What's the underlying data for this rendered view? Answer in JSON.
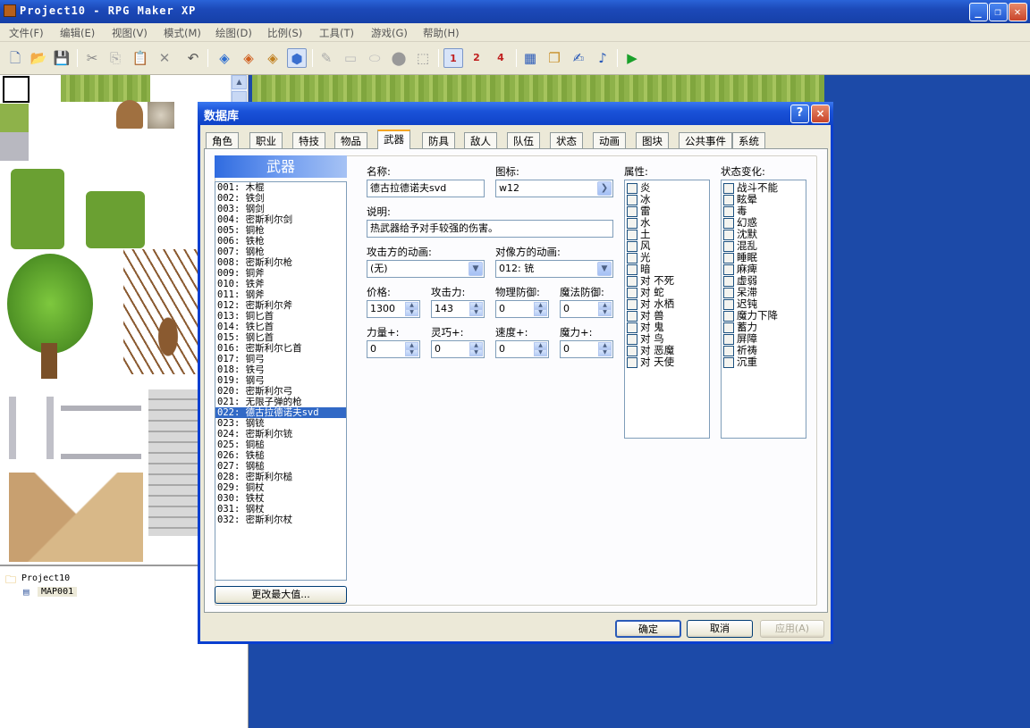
{
  "app": {
    "title": "Project10 - RPG Maker XP"
  },
  "menu": [
    "文件(F)",
    "编辑(E)",
    "视图(V)",
    "模式(M)",
    "绘图(D)",
    "比例(S)",
    "工具(T)",
    "游戏(G)",
    "帮助(H)"
  ],
  "toolbar_icons": [
    "new-icon",
    "open-icon",
    "save-icon",
    "cut-icon",
    "copy-icon",
    "paste-icon",
    "delete-icon",
    "undo-icon",
    "layer1-icon",
    "layer2-icon",
    "layer3-icon",
    "events-icon",
    "pencil-icon",
    "rectangle-icon",
    "ellipse-icon",
    "fill-icon",
    "select-icon",
    "zoom-1-icon",
    "zoom-2-icon",
    "zoom-4-icon",
    "database-icon",
    "materials-icon",
    "script-icon",
    "sound-icon",
    "play-icon"
  ],
  "map_tree": {
    "project": "Project10",
    "map": "MAP001"
  },
  "dialog": {
    "title": "数据库",
    "help_button": "?",
    "close_button": "×",
    "tabs": [
      "角色",
      "职业",
      "特技",
      "物品",
      "武器",
      "防具",
      "敌人",
      "队伍",
      "状态",
      "动画",
      "图块",
      "公共事件",
      "系统"
    ],
    "selected_tab": "武器",
    "list_header": "武器",
    "weapons": [
      "001: 木棍",
      "002: 铁剑",
      "003: 钢剑",
      "004: 密斯利尔剑",
      "005: 铜枪",
      "006: 铁枪",
      "007: 钢枪",
      "008: 密斯利尔枪",
      "009: 铜斧",
      "010: 铁斧",
      "011: 钢斧",
      "012: 密斯利尔斧",
      "013: 铜匕首",
      "014: 铁匕首",
      "015: 钢匕首",
      "016: 密斯利尔匕首",
      "017: 铜弓",
      "018: 铁弓",
      "019: 钢弓",
      "020: 密斯利尔弓",
      "021: 无限子弹的枪",
      "022: 德古拉德诺夫svd",
      "023: 钢铳",
      "024: 密斯利尔铳",
      "025: 铜槌",
      "026: 铁槌",
      "027: 钢槌",
      "028: 密斯利尔槌",
      "029: 铜杖",
      "030: 铁杖",
      "031: 钢杖",
      "032: 密斯利尔杖"
    ],
    "selected_weapon": "022: 德古拉德诺夫svd",
    "max_button": "更改最大值...",
    "form": {
      "name_label": "名称:",
      "name_value": "德古拉德诺夫svd",
      "icon_label": "图标:",
      "icon_value": "w12",
      "desc_label": "说明:",
      "desc_value": "热武器给予对手较强的伤害。",
      "attacker_anim_label": "攻击方的动画:",
      "attacker_anim_value": "(无)",
      "target_anim_label": "对像方的动画:",
      "target_anim_value": "012: 铳",
      "price_label": "价格:",
      "price_value": "1300",
      "atk_label": "攻击力:",
      "atk_value": "143",
      "pdef_label": "物理防御:",
      "pdef_value": "0",
      "mdef_label": "魔法防御:",
      "mdef_value": "0",
      "str_label": "力量+:",
      "str_value": "0",
      "dex_label": "灵巧+:",
      "dex_value": "0",
      "agi_label": "速度+:",
      "agi_value": "0",
      "int_label": "魔力+:",
      "int_value": "0"
    },
    "elements_label": "属性:",
    "elements": [
      "炎",
      "冰",
      "雷",
      "水",
      "土",
      "风",
      "光",
      "暗",
      "对 不死",
      "对 蛇",
      "对 水栖",
      "对 兽",
      "对 鬼",
      "对 鸟",
      "对 恶魔",
      "对 天使"
    ],
    "states_label": "状态变化:",
    "states": [
      "战斗不能",
      "眩晕",
      "毒",
      "幻惑",
      "沈默",
      "混乱",
      "睡眠",
      "麻痺",
      "虚弱",
      "呆滞",
      "迟钝",
      "魔力下降",
      "蓄力",
      "屏障",
      "祈祷",
      "沉重"
    ],
    "ok_button": "确定",
    "cancel_button": "取消",
    "apply_button": "应用(A)"
  }
}
